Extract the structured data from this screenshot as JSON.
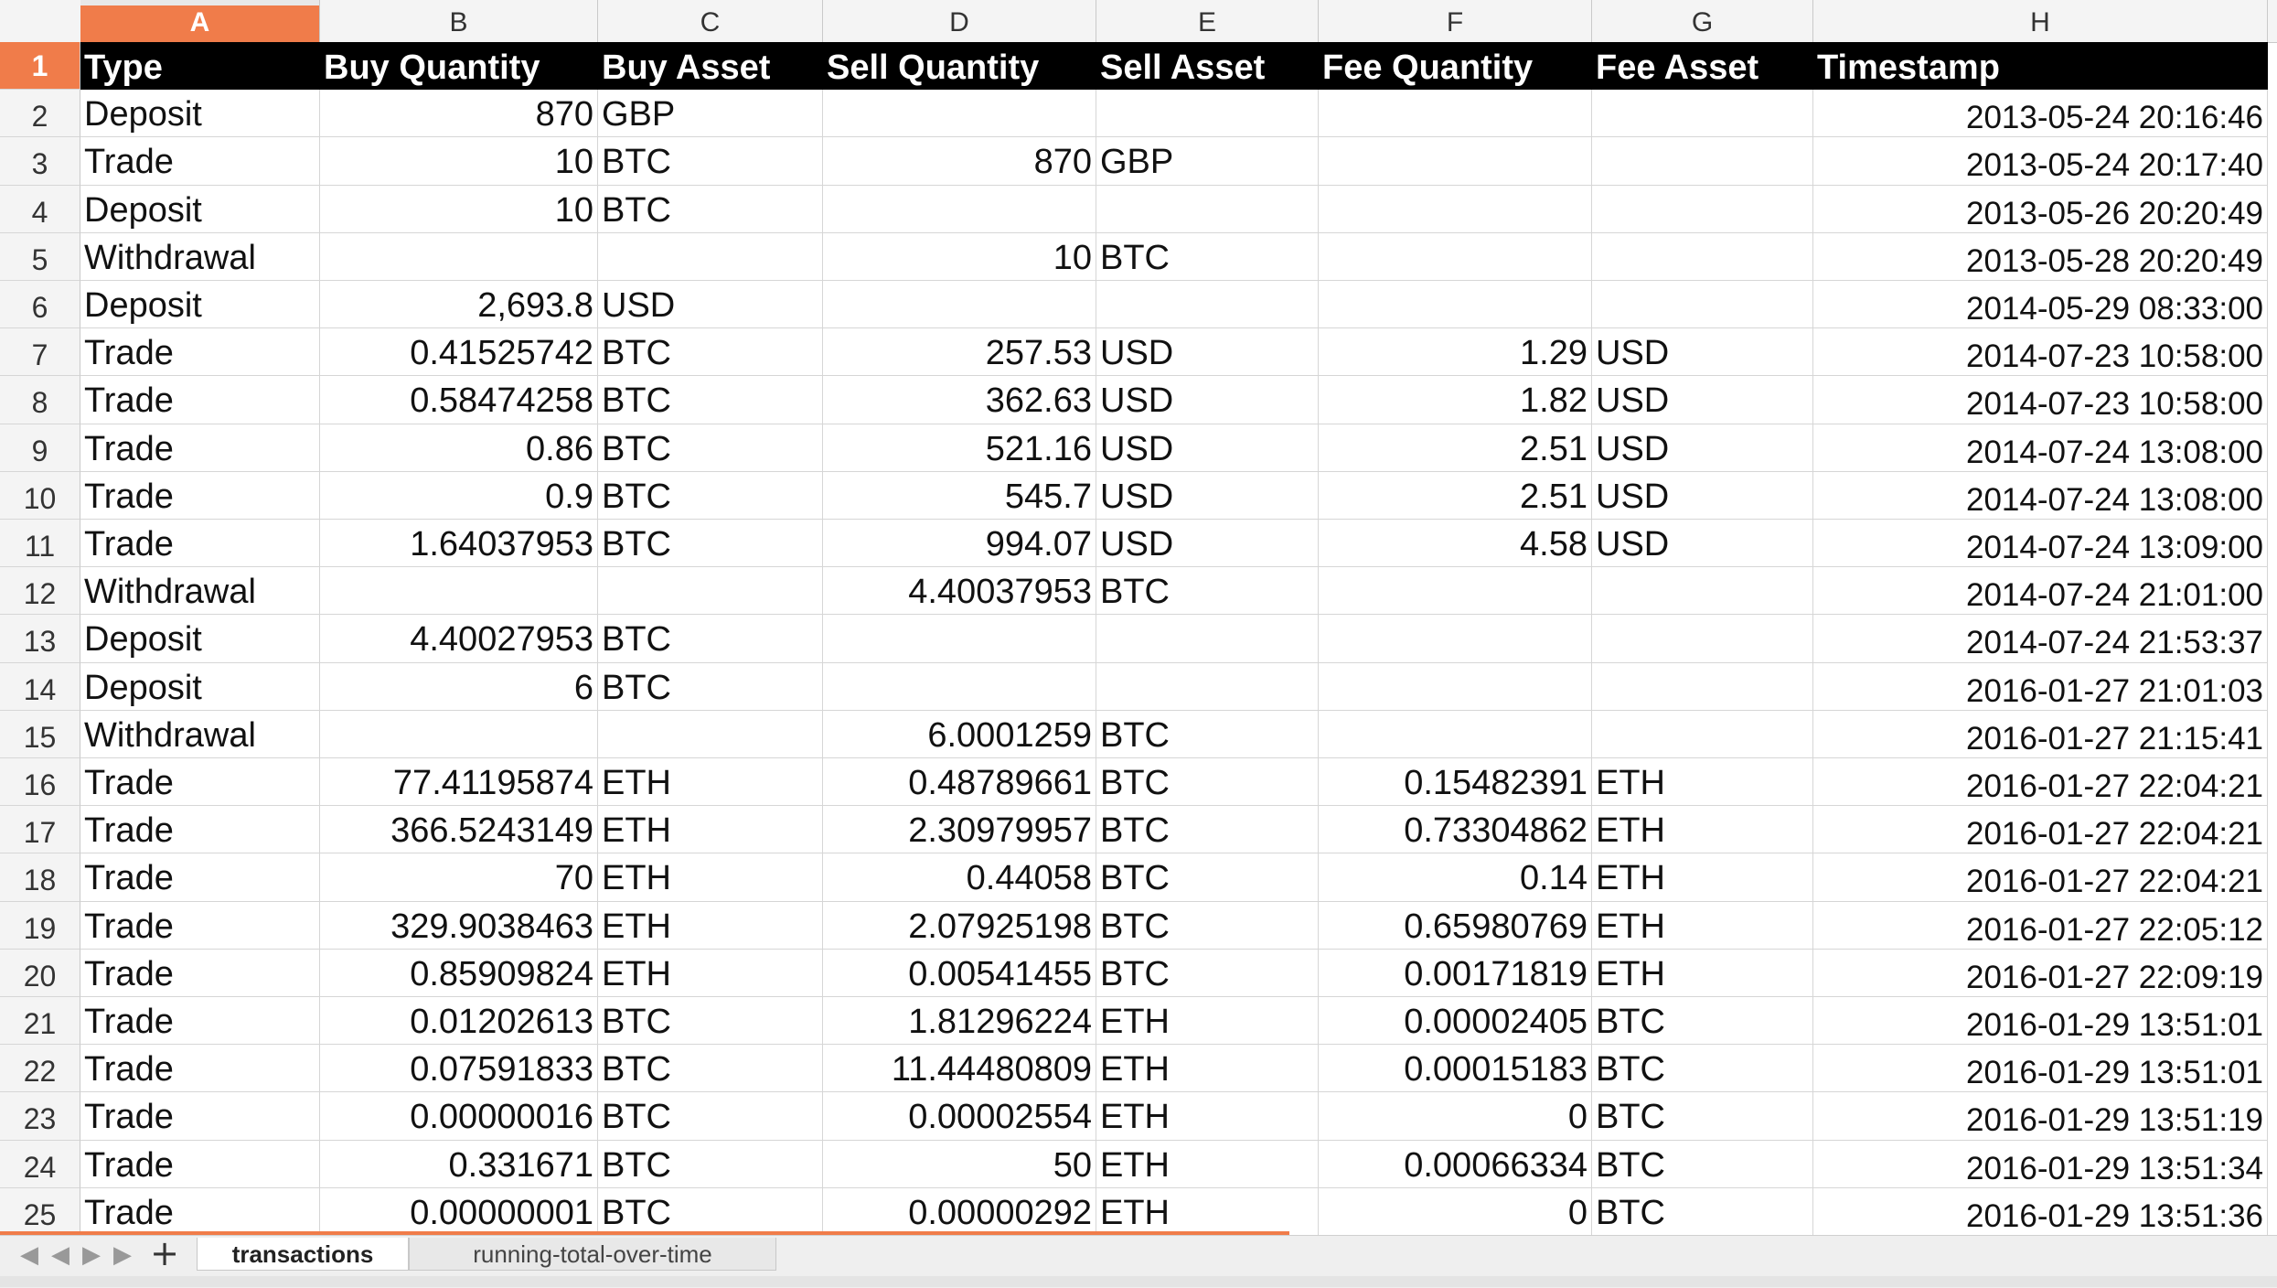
{
  "columns": [
    "A",
    "B",
    "C",
    "D",
    "E",
    "F",
    "G",
    "H"
  ],
  "active_column": "A",
  "active_row": 1,
  "headers": [
    "Type",
    "Buy Quantity",
    "Buy Asset",
    "Sell Quantity",
    "Sell Asset",
    "Fee Quantity",
    "Fee Asset",
    "Timestamp"
  ],
  "rows": [
    {
      "n": "2",
      "type": "Deposit",
      "buy_qty": "870",
      "buy_asset": "GBP",
      "sell_qty": "",
      "sell_asset": "",
      "fee_qty": "",
      "fee_asset": "",
      "ts": "2013-05-24 20:16:46"
    },
    {
      "n": "3",
      "type": "Trade",
      "buy_qty": "10",
      "buy_asset": "BTC",
      "sell_qty": "870",
      "sell_asset": "GBP",
      "fee_qty": "",
      "fee_asset": "",
      "ts": "2013-05-24 20:17:40"
    },
    {
      "n": "4",
      "type": "Deposit",
      "buy_qty": "10",
      "buy_asset": "BTC",
      "sell_qty": "",
      "sell_asset": "",
      "fee_qty": "",
      "fee_asset": "",
      "ts": "2013-05-26 20:20:49"
    },
    {
      "n": "5",
      "type": "Withdrawal",
      "buy_qty": "",
      "buy_asset": "",
      "sell_qty": "10",
      "sell_asset": "BTC",
      "fee_qty": "",
      "fee_asset": "",
      "ts": "2013-05-28 20:20:49"
    },
    {
      "n": "6",
      "type": "Deposit",
      "buy_qty": "2,693.8",
      "buy_asset": "USD",
      "sell_qty": "",
      "sell_asset": "",
      "fee_qty": "",
      "fee_asset": "",
      "ts": "2014-05-29 08:33:00"
    },
    {
      "n": "7",
      "type": "Trade",
      "buy_qty": "0.41525742",
      "buy_asset": "BTC",
      "sell_qty": "257.53",
      "sell_asset": "USD",
      "fee_qty": "1.29",
      "fee_asset": "USD",
      "ts": "2014-07-23 10:58:00"
    },
    {
      "n": "8",
      "type": "Trade",
      "buy_qty": "0.58474258",
      "buy_asset": "BTC",
      "sell_qty": "362.63",
      "sell_asset": "USD",
      "fee_qty": "1.82",
      "fee_asset": "USD",
      "ts": "2014-07-23 10:58:00"
    },
    {
      "n": "9",
      "type": "Trade",
      "buy_qty": "0.86",
      "buy_asset": "BTC",
      "sell_qty": "521.16",
      "sell_asset": "USD",
      "fee_qty": "2.51",
      "fee_asset": "USD",
      "ts": "2014-07-24 13:08:00"
    },
    {
      "n": "10",
      "type": "Trade",
      "buy_qty": "0.9",
      "buy_asset": "BTC",
      "sell_qty": "545.7",
      "sell_asset": "USD",
      "fee_qty": "2.51",
      "fee_asset": "USD",
      "ts": "2014-07-24 13:08:00"
    },
    {
      "n": "11",
      "type": "Trade",
      "buy_qty": "1.64037953",
      "buy_asset": "BTC",
      "sell_qty": "994.07",
      "sell_asset": "USD",
      "fee_qty": "4.58",
      "fee_asset": "USD",
      "ts": "2014-07-24 13:09:00"
    },
    {
      "n": "12",
      "type": "Withdrawal",
      "buy_qty": "",
      "buy_asset": "",
      "sell_qty": "4.40037953",
      "sell_asset": "BTC",
      "fee_qty": "",
      "fee_asset": "",
      "ts": "2014-07-24 21:01:00"
    },
    {
      "n": "13",
      "type": "Deposit",
      "buy_qty": "4.40027953",
      "buy_asset": "BTC",
      "sell_qty": "",
      "sell_asset": "",
      "fee_qty": "",
      "fee_asset": "",
      "ts": "2014-07-24 21:53:37"
    },
    {
      "n": "14",
      "type": "Deposit",
      "buy_qty": "6",
      "buy_asset": "BTC",
      "sell_qty": "",
      "sell_asset": "",
      "fee_qty": "",
      "fee_asset": "",
      "ts": "2016-01-27 21:01:03"
    },
    {
      "n": "15",
      "type": "Withdrawal",
      "buy_qty": "",
      "buy_asset": "",
      "sell_qty": "6.0001259",
      "sell_asset": "BTC",
      "fee_qty": "",
      "fee_asset": "",
      "ts": "2016-01-27 21:15:41"
    },
    {
      "n": "16",
      "type": "Trade",
      "buy_qty": "77.41195874",
      "buy_asset": "ETH",
      "sell_qty": "0.48789661",
      "sell_asset": "BTC",
      "fee_qty": "0.15482391",
      "fee_asset": "ETH",
      "ts": "2016-01-27 22:04:21"
    },
    {
      "n": "17",
      "type": "Trade",
      "buy_qty": "366.5243149",
      "buy_asset": "ETH",
      "sell_qty": "2.30979957",
      "sell_asset": "BTC",
      "fee_qty": "0.73304862",
      "fee_asset": "ETH",
      "ts": "2016-01-27 22:04:21"
    },
    {
      "n": "18",
      "type": "Trade",
      "buy_qty": "70",
      "buy_asset": "ETH",
      "sell_qty": "0.44058",
      "sell_asset": "BTC",
      "fee_qty": "0.14",
      "fee_asset": "ETH",
      "ts": "2016-01-27 22:04:21"
    },
    {
      "n": "19",
      "type": "Trade",
      "buy_qty": "329.9038463",
      "buy_asset": "ETH",
      "sell_qty": "2.07925198",
      "sell_asset": "BTC",
      "fee_qty": "0.65980769",
      "fee_asset": "ETH",
      "ts": "2016-01-27 22:05:12"
    },
    {
      "n": "20",
      "type": "Trade",
      "buy_qty": "0.85909824",
      "buy_asset": "ETH",
      "sell_qty": "0.00541455",
      "sell_asset": "BTC",
      "fee_qty": "0.00171819",
      "fee_asset": "ETH",
      "ts": "2016-01-27 22:09:19"
    },
    {
      "n": "21",
      "type": "Trade",
      "buy_qty": "0.01202613",
      "buy_asset": "BTC",
      "sell_qty": "1.81296224",
      "sell_asset": "ETH",
      "fee_qty": "0.00002405",
      "fee_asset": "BTC",
      "ts": "2016-01-29 13:51:01"
    },
    {
      "n": "22",
      "type": "Trade",
      "buy_qty": "0.07591833",
      "buy_asset": "BTC",
      "sell_qty": "11.44480809",
      "sell_asset": "ETH",
      "fee_qty": "0.00015183",
      "fee_asset": "BTC",
      "ts": "2016-01-29 13:51:01"
    },
    {
      "n": "23",
      "type": "Trade",
      "buy_qty": "0.00000016",
      "buy_asset": "BTC",
      "sell_qty": "0.00002554",
      "sell_asset": "ETH",
      "fee_qty": "0",
      "fee_asset": "BTC",
      "ts": "2016-01-29 13:51:19"
    },
    {
      "n": "24",
      "type": "Trade",
      "buy_qty": "0.331671",
      "buy_asset": "BTC",
      "sell_qty": "50",
      "sell_asset": "ETH",
      "fee_qty": "0.00066334",
      "fee_asset": "BTC",
      "ts": "2016-01-29 13:51:34"
    },
    {
      "n": "25",
      "type": "Trade",
      "buy_qty": "0.00000001",
      "buy_asset": "BTC",
      "sell_qty": "0.00000292",
      "sell_asset": "ETH",
      "fee_qty": "0",
      "fee_asset": "BTC",
      "ts": "2016-01-29 13:51:36"
    }
  ],
  "tabs": {
    "first": "◀",
    "prev": "◀",
    "next": "▶",
    "last": "▶",
    "add": "+",
    "active": "transactions",
    "other": "running-total-over-time"
  },
  "colors": {
    "accent": "#f07c4a",
    "header_bg": "#000000"
  }
}
